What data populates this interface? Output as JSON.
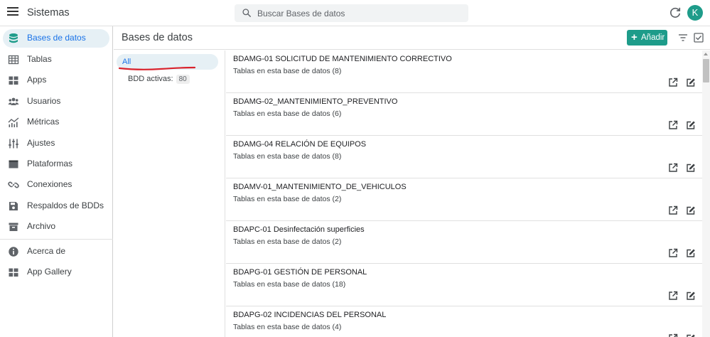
{
  "header": {
    "app_title": "Sistemas",
    "search_placeholder": "Buscar Bases de datos",
    "avatar_letter": "K"
  },
  "sidebar": {
    "items": [
      {
        "label": "Bases de datos",
        "icon": "database-icon",
        "active": true
      },
      {
        "label": "Tablas",
        "icon": "table-icon"
      },
      {
        "label": "Apps",
        "icon": "apps-icon"
      },
      {
        "label": "Usuarios",
        "icon": "users-icon"
      },
      {
        "label": "Métricas",
        "icon": "metrics-icon"
      },
      {
        "label": "Ajustes",
        "icon": "settings-sliders-icon"
      },
      {
        "label": "Plataformas",
        "icon": "platform-icon"
      },
      {
        "label": "Conexiones",
        "icon": "link-icon"
      },
      {
        "label": "Respaldos de BDDs",
        "icon": "save-icon"
      },
      {
        "label": "Archivo",
        "icon": "archive-icon"
      },
      {
        "label": "Acerca de",
        "icon": "info-icon"
      },
      {
        "label": "App Gallery",
        "icon": "gallery-icon"
      }
    ]
  },
  "content": {
    "title": "Bases de datos",
    "add_label": "Añadir"
  },
  "filters": {
    "all_label": "All",
    "active_label": "BDD activas:",
    "active_count": "80"
  },
  "databases": [
    {
      "name": "BDAMG-01 SOLICITUD DE MANTENIMIENTO CORRECTIVO",
      "subtitle": "Tablas en esta base de datos (8)"
    },
    {
      "name": "BDAMG-02_MANTENIMIENTO_PREVENTIVO",
      "subtitle": "Tablas en esta base de datos (6)"
    },
    {
      "name": "BDAMG-04 RELACIÓN DE EQUIPOS",
      "subtitle": "Tablas en esta base de datos (8)"
    },
    {
      "name": "BDAMV-01_MANTENIMIENTO_DE_VEHICULOS",
      "subtitle": "Tablas en esta base de datos (2)"
    },
    {
      "name": "BDAPC-01 Desinfectación superficies",
      "subtitle": "Tablas en esta base de datos (2)"
    },
    {
      "name": "BDAPG-01 GESTIÓN DE PERSONAL",
      "subtitle": "Tablas en esta base de datos (18)"
    },
    {
      "name": "BDAPG-02 INCIDENCIAS DEL PERSONAL",
      "subtitle": "Tablas en esta base de datos (4)"
    }
  ],
  "colors": {
    "accent": "#1e9c8a",
    "active_bg": "#e6f0f5",
    "active_text": "#1a73e8",
    "annotation": "#d9232d"
  }
}
